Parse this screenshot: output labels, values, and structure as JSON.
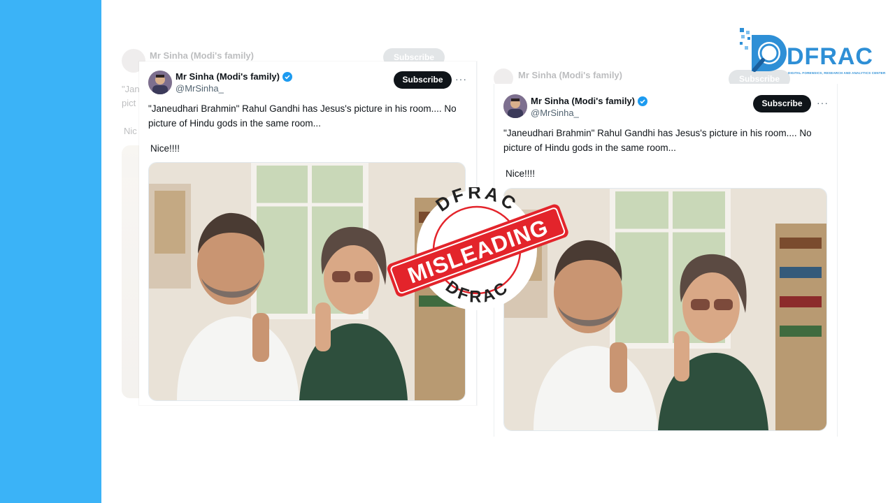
{
  "tweet": {
    "display_name": "Mr Sinha (Modi's family)",
    "handle": "@MrSinha_",
    "subscribe_label": "Subscribe",
    "more_label": "···",
    "text": "\"Janeudhari Brahmin\" Rahul Gandhi has Jesus's picture in his room.... No picture of Hindu gods in the same room...",
    "text_line1": "\"Janeudhari Brahmin\" Rahul Gandhi has Jesus's picture in his room.... No",
    "text_line2": "picture of Hindu gods in the same room...",
    "nice": "Nice!!!!"
  },
  "ghost": {
    "snippet_1": "\"Jan",
    "snippet_2": "pict",
    "snippet_3": "Nic"
  },
  "stamp": {
    "verdict": "MISLEADING",
    "brand_top": "DFRAC",
    "brand_bottom": "DFRAC"
  },
  "logo": {
    "name": "DFRAC",
    "tagline": "DIGITAL FORENSICS, RESEARCH AND ANALYTICS CENTER"
  },
  "colors": {
    "side_bar": "#3bb3f7",
    "stamp_red": "#e3242b",
    "brand_blue": "#2e8fd6",
    "verified": "#1d9bf0"
  }
}
